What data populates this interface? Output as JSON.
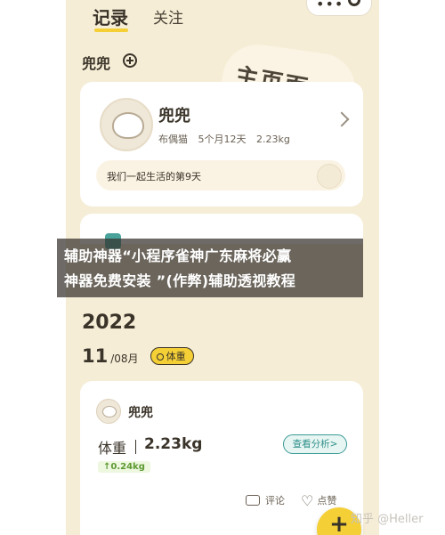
{
  "header": {
    "tab_record": "记录",
    "tab_follow": "关注",
    "capsule_dots": "•••"
  },
  "pet_selector": {
    "name": "兜兜"
  },
  "home_tag": "主页面",
  "pet_card": {
    "name": "兜兜",
    "breed": "布偶猫",
    "age": "5个月12天",
    "weight": "2.23kg",
    "together_text": "我们一起生活的第9天"
  },
  "timeline": {
    "year": "2022",
    "day": "11",
    "month": "/08月",
    "badge": "体重"
  },
  "record_card": {
    "pet_name": "兜兜",
    "weight_label": "体重",
    "weight_value": "2.23kg",
    "analysis_button": "查看分析>",
    "delta": "↑0.24kg",
    "comment_label": "评论",
    "like_label": "点赞"
  },
  "fab": {
    "label": "+"
  },
  "overlay_banner": {
    "line1": "辅助神器“小程序雀神广东麻将必赢",
    "line2": "神器免费安装 ”(作弊)辅助透视教程"
  },
  "watermark": "知乎 @Heller"
}
